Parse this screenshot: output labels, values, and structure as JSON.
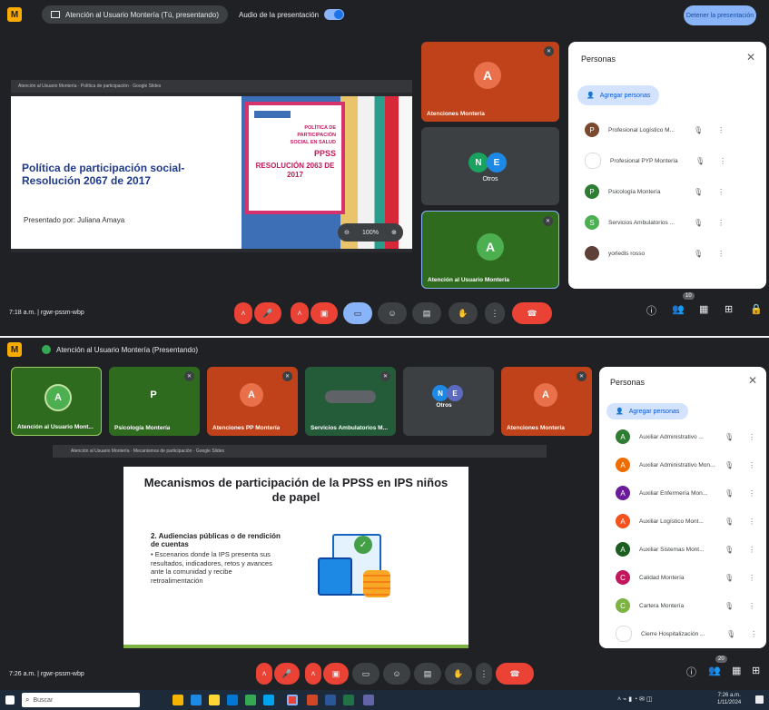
{
  "top": {
    "present_label": "Atención al Usuario Montería (Tú, presentando)",
    "audio_label": "Audio de la presentación",
    "stop_label": "Detener la presentación",
    "slide_window_title": "Atención al Usuario Montería · Política de participación · Google Slides",
    "slide": {
      "title": "Política de participación social-Resolución 2067 de 2017",
      "presenter": "Presentado por: Juliana Amaya",
      "cover_lines": [
        "POLÍTICA DE",
        "PARTICIPACIÓN",
        "SOCIAL EN SALUD",
        "PPSS"
      ],
      "cover_res": "RESOLUCIÓN 2063 DE 2017",
      "zoom": "100%"
    },
    "tiles": [
      {
        "name": "Atenciones Montería",
        "initial": "A"
      },
      {
        "name": "Otros",
        "initials": [
          "N",
          "E"
        ]
      },
      {
        "name": "Atención al Usuario Montería",
        "initial": "A"
      }
    ],
    "people": {
      "title": "Personas",
      "add": "Agregar personas",
      "rows": [
        {
          "name": "Profesional Logístico M...",
          "initial": "P",
          "color": "#7b4a2e"
        },
        {
          "name": "Profesional PYP Montería",
          "initial": "",
          "color": "#ffffff"
        },
        {
          "name": "Psicología Montería",
          "initial": "P",
          "color": "#2e7d32"
        },
        {
          "name": "Servicios Ambulatorios ...",
          "initial": "S",
          "color": "#4caf50"
        },
        {
          "name": "yorledis rosso",
          "initial": "",
          "color": "#5d4037"
        }
      ]
    },
    "clock": "7:18 a.m.",
    "meeting_code": "rgwr-pssm-wbp",
    "badge": "10"
  },
  "bottom": {
    "present_label": "Atención al Usuario Montería (Presentando)",
    "slide_window_title": "Atención al Usuario Montería · Mecanismos de participación · Google Slides",
    "slide": {
      "title": "Mecanismos de participación de la PPSS en IPS niños de papel",
      "subtitle": "2. Audiencias públicas o de rendición de cuentas",
      "body": "• Escenarios donde la IPS presenta sus resultados, indicadores, retos y avances ante la comunidad y recibe retroalimentación"
    },
    "tiles": [
      {
        "name": "Atención al Usuario Mont...",
        "initial": "A"
      },
      {
        "name": "Psicología Montería",
        "initial": "P"
      },
      {
        "name": "Atenciones PP Montería",
        "initial": "A"
      },
      {
        "name": "Servicios Ambulatorios M...",
        "initial": ""
      },
      {
        "name": "Otros",
        "initials": [
          "N",
          "E"
        ]
      },
      {
        "name": "Atenciones Montería",
        "initial": "A"
      }
    ],
    "people": {
      "title": "Personas",
      "add": "Agregar personas",
      "rows": [
        {
          "name": "Auxiliar Administrativo ...",
          "initial": "A",
          "color": "#2e7d32"
        },
        {
          "name": "Auxiliar Administrativo Mon...",
          "initial": "A",
          "color": "#ef6c00"
        },
        {
          "name": "Auxiliar Enfermería Mon...",
          "initial": "A",
          "color": "#6a1b9a"
        },
        {
          "name": "Auxiliar Logístico Mont...",
          "initial": "A",
          "color": "#f4511e"
        },
        {
          "name": "Auxiliar Sistemas Mont...",
          "initial": "A",
          "color": "#1b5e20"
        },
        {
          "name": "Calidad Montería",
          "initial": "C",
          "color": "#c2185b"
        },
        {
          "name": "Cartera Montería",
          "initial": "C",
          "color": "#7cb342"
        },
        {
          "name": "Cierre Hospitalización ...",
          "initial": "",
          "color": "#ffffff"
        }
      ]
    },
    "clock": "7:26 a.m.",
    "meeting_code": "rgwr-pssm-wbp",
    "badge": "20"
  },
  "taskbar": {
    "search": "Buscar",
    "clock": "7:26 a.m.",
    "date": "1/11/2024"
  },
  "colors": {
    "meet_bg": "#202124",
    "tile_orange": "#c0421a",
    "tile_green": "#2e6b1f",
    "tile_dark": "#3c4043",
    "hangup": "#ea4335"
  }
}
